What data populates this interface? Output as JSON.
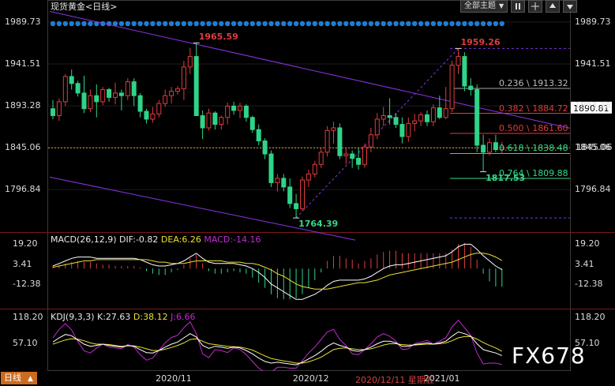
{
  "window": {
    "instrument": "现货黄金",
    "period_label": "<日线>",
    "toolbar": {
      "theme_label": "全部主题",
      "theme_arrow": "▼"
    },
    "period_tab": "日线",
    "period_tab_arrow": "▲"
  },
  "colors": {
    "background": "#000000",
    "up": "#e03c3c",
    "down": "#2fd488",
    "channel": "#8a35e8",
    "fib_line": "#a7a7a7",
    "price_line": "#d9a441",
    "macd_dif": "#ffffff",
    "macd_dea": "#e8e030",
    "macd_pos_bar": "#e03c3c",
    "macd_neg_bar": "#2fd488",
    "kdj_k": "#ffffff",
    "kdj_d": "#e8e030",
    "kdj_j": "#c22ad0",
    "event_dot": "#1e7ed6",
    "accent_red": "#e03c3c",
    "accent_green": "#34d888"
  },
  "chart_data": [
    {
      "type": "candlestick",
      "title": "现货黄金 <日线>",
      "y_ticks": [
        "1989.73",
        "1941.51",
        "1893.28",
        "1845.06",
        "1796.84"
      ],
      "y_tick_values": [
        1989.73,
        1941.51,
        1893.28,
        1845.06,
        1796.84
      ],
      "ylim": [
        1750,
        1995
      ],
      "x_tick_labels": [
        "2020/11",
        "2020/12",
        "2021/01"
      ],
      "x_cursor_label": "2020/12/11 星期五",
      "current_price": "1845.06",
      "last_close_tag": "1845.06",
      "right_marker_price": "1890.81",
      "annotations": [
        {
          "text": "1965.59",
          "value": 1965.59,
          "type": "high"
        },
        {
          "text": "1764.39",
          "value": 1764.39,
          "type": "low"
        },
        {
          "text": "1959.26",
          "value": 1959.26,
          "type": "high"
        },
        {
          "text": "1817.53",
          "value": 1817.53,
          "type": "low"
        }
      ],
      "fibonacci": [
        {
          "label": "0.236 \\ 1913.32",
          "ratio": 0.236,
          "value": 1913.32,
          "color": "#bdbdbd"
        },
        {
          "label": "0.382 \\ 1884.72",
          "ratio": 0.382,
          "value": 1884.72,
          "color": "#e03c3c"
        },
        {
          "label": "0.500 \\ 1861.60",
          "ratio": 0.5,
          "value": 1861.6,
          "color": "#e03c3c"
        },
        {
          "label": "0.618 \\ 1838.48",
          "ratio": 0.618,
          "value": 1838.48,
          "color": "#34d888"
        },
        {
          "label": "0.764 \\ 1809.88",
          "ratio": 0.764,
          "value": 1809.88,
          "color": "#34d888"
        }
      ],
      "fib_top": 1959.26,
      "fib_bottom": 1764.39,
      "candles": [
        {
          "o": 1890,
          "h": 1900,
          "l": 1878,
          "c": 1882
        },
        {
          "o": 1882,
          "h": 1902,
          "l": 1876,
          "c": 1898
        },
        {
          "o": 1898,
          "h": 1930,
          "l": 1893,
          "c": 1927
        },
        {
          "o": 1927,
          "h": 1935,
          "l": 1912,
          "c": 1919
        },
        {
          "o": 1919,
          "h": 1922,
          "l": 1904,
          "c": 1908
        },
        {
          "o": 1908,
          "h": 1928,
          "l": 1885,
          "c": 1890
        },
        {
          "o": 1890,
          "h": 1912,
          "l": 1886,
          "c": 1905
        },
        {
          "o": 1905,
          "h": 1918,
          "l": 1880,
          "c": 1898
        },
        {
          "o": 1898,
          "h": 1915,
          "l": 1894,
          "c": 1912
        },
        {
          "o": 1912,
          "h": 1914,
          "l": 1898,
          "c": 1903
        },
        {
          "o": 1903,
          "h": 1920,
          "l": 1895,
          "c": 1908
        },
        {
          "o": 1908,
          "h": 1912,
          "l": 1888,
          "c": 1905
        },
        {
          "o": 1905,
          "h": 1925,
          "l": 1900,
          "c": 1921
        },
        {
          "o": 1921,
          "h": 1925,
          "l": 1893,
          "c": 1905
        },
        {
          "o": 1905,
          "h": 1908,
          "l": 1880,
          "c": 1887
        },
        {
          "o": 1887,
          "h": 1890,
          "l": 1873,
          "c": 1878
        },
        {
          "o": 1878,
          "h": 1892,
          "l": 1874,
          "c": 1884
        },
        {
          "o": 1884,
          "h": 1900,
          "l": 1880,
          "c": 1896
        },
        {
          "o": 1896,
          "h": 1912,
          "l": 1892,
          "c": 1905
        },
        {
          "o": 1905,
          "h": 1915,
          "l": 1896,
          "c": 1910
        },
        {
          "o": 1910,
          "h": 1916,
          "l": 1906,
          "c": 1913
        },
        {
          "o": 1913,
          "h": 1945,
          "l": 1900,
          "c": 1938
        },
        {
          "o": 1938,
          "h": 1960,
          "l": 1930,
          "c": 1950
        },
        {
          "o": 1950,
          "h": 1965.59,
          "l": 1938,
          "c": 1882
        },
        {
          "o": 1882,
          "h": 1888,
          "l": 1855,
          "c": 1868
        },
        {
          "o": 1868,
          "h": 1890,
          "l": 1865,
          "c": 1885
        },
        {
          "o": 1885,
          "h": 1887,
          "l": 1866,
          "c": 1872
        },
        {
          "o": 1872,
          "h": 1882,
          "l": 1866,
          "c": 1880
        },
        {
          "o": 1880,
          "h": 1897,
          "l": 1872,
          "c": 1893
        },
        {
          "o": 1893,
          "h": 1898,
          "l": 1883,
          "c": 1888
        },
        {
          "o": 1888,
          "h": 1897,
          "l": 1879,
          "c": 1893
        },
        {
          "o": 1893,
          "h": 1895,
          "l": 1875,
          "c": 1880
        },
        {
          "o": 1880,
          "h": 1882,
          "l": 1862,
          "c": 1866
        },
        {
          "o": 1866,
          "h": 1872,
          "l": 1848,
          "c": 1853
        },
        {
          "o": 1853,
          "h": 1856,
          "l": 1832,
          "c": 1838
        },
        {
          "o": 1838,
          "h": 1842,
          "l": 1800,
          "c": 1805
        },
        {
          "o": 1805,
          "h": 1815,
          "l": 1795,
          "c": 1810
        },
        {
          "o": 1810,
          "h": 1815,
          "l": 1795,
          "c": 1800
        },
        {
          "o": 1800,
          "h": 1810,
          "l": 1776,
          "c": 1781
        },
        {
          "o": 1781,
          "h": 1792,
          "l": 1764.39,
          "c": 1775
        },
        {
          "o": 1775,
          "h": 1812,
          "l": 1773,
          "c": 1808
        },
        {
          "o": 1808,
          "h": 1820,
          "l": 1800,
          "c": 1815
        },
        {
          "o": 1815,
          "h": 1830,
          "l": 1811,
          "c": 1826
        },
        {
          "o": 1826,
          "h": 1845,
          "l": 1822,
          "c": 1840
        },
        {
          "o": 1840,
          "h": 1870,
          "l": 1835,
          "c": 1865
        },
        {
          "o": 1865,
          "h": 1875,
          "l": 1850,
          "c": 1868
        },
        {
          "o": 1868,
          "h": 1873,
          "l": 1832,
          "c": 1836
        },
        {
          "o": 1836,
          "h": 1845,
          "l": 1826,
          "c": 1838
        },
        {
          "o": 1838,
          "h": 1842,
          "l": 1822,
          "c": 1833
        },
        {
          "o": 1833,
          "h": 1845,
          "l": 1820,
          "c": 1826
        },
        {
          "o": 1826,
          "h": 1850,
          "l": 1822,
          "c": 1846
        },
        {
          "o": 1846,
          "h": 1868,
          "l": 1840,
          "c": 1860
        },
        {
          "o": 1860,
          "h": 1885,
          "l": 1855,
          "c": 1878
        },
        {
          "o": 1878,
          "h": 1892,
          "l": 1870,
          "c": 1882
        },
        {
          "o": 1882,
          "h": 1902,
          "l": 1872,
          "c": 1880
        },
        {
          "o": 1880,
          "h": 1885,
          "l": 1868,
          "c": 1872
        },
        {
          "o": 1872,
          "h": 1880,
          "l": 1850,
          "c": 1858
        },
        {
          "o": 1858,
          "h": 1880,
          "l": 1852,
          "c": 1873
        },
        {
          "o": 1873,
          "h": 1884,
          "l": 1864,
          "c": 1876
        },
        {
          "o": 1876,
          "h": 1886,
          "l": 1870,
          "c": 1883
        },
        {
          "o": 1883,
          "h": 1888,
          "l": 1870,
          "c": 1875
        },
        {
          "o": 1875,
          "h": 1895,
          "l": 1870,
          "c": 1891
        },
        {
          "o": 1891,
          "h": 1905,
          "l": 1878,
          "c": 1880
        },
        {
          "o": 1880,
          "h": 1915,
          "l": 1878,
          "c": 1890
        },
        {
          "o": 1890,
          "h": 1945,
          "l": 1886,
          "c": 1940
        },
        {
          "o": 1940,
          "h": 1959.26,
          "l": 1930,
          "c": 1950
        },
        {
          "o": 1950,
          "h": 1955,
          "l": 1910,
          "c": 1916
        },
        {
          "o": 1916,
          "h": 1925,
          "l": 1905,
          "c": 1912
        },
        {
          "o": 1912,
          "h": 1918,
          "l": 1840,
          "c": 1848
        },
        {
          "o": 1848,
          "h": 1860,
          "l": 1817.53,
          "c": 1840
        },
        {
          "o": 1840,
          "h": 1856,
          "l": 1836,
          "c": 1851
        },
        {
          "o": 1851,
          "h": 1860,
          "l": 1840,
          "c": 1843
        },
        {
          "o": 1843,
          "h": 1852,
          "l": 1838,
          "c": 1845.06
        }
      ]
    },
    {
      "type": "macd",
      "title": "MACD(26,12,9)",
      "legend": [
        {
          "label": "DIF:-0.82",
          "color": "#ffffff"
        },
        {
          "label": "DEA:6.26",
          "color": "#e8e030"
        },
        {
          "label": "MACD:-14.16",
          "color": "#c22ad0"
        }
      ],
      "y_ticks": [
        "19.20",
        "3.41",
        "-12.38"
      ],
      "y_tick_values": [
        19.2,
        3.41,
        -12.38
      ],
      "ylim": [
        -30,
        26
      ],
      "dif": [
        2,
        4,
        6,
        8,
        9,
        9,
        9,
        8,
        8,
        8,
        8,
        8,
        8,
        8,
        7,
        5,
        3,
        2,
        2,
        3,
        4,
        6,
        9,
        12,
        8,
        5,
        4,
        4,
        4,
        4,
        3,
        2,
        0,
        -3,
        -7,
        -12,
        -15,
        -18,
        -21,
        -24,
        -24,
        -22,
        -20,
        -17,
        -13,
        -10,
        -9,
        -9,
        -9,
        -9,
        -8,
        -6,
        -3,
        0,
        2,
        3,
        3,
        4,
        5,
        6,
        7,
        8,
        9,
        10,
        13,
        17,
        19,
        19,
        15,
        10,
        6,
        2,
        -0.82
      ],
      "dea": [
        1,
        2,
        3,
        4,
        5,
        6,
        6,
        7,
        7,
        7,
        7,
        7,
        7,
        7,
        7,
        7,
        6,
        5,
        5,
        4,
        4,
        4,
        5,
        6,
        6,
        6,
        6,
        6,
        5,
        5,
        5,
        4,
        4,
        3,
        1,
        -1,
        -4,
        -6,
        -9,
        -12,
        -14,
        -15,
        -16,
        -16,
        -16,
        -15,
        -14,
        -13,
        -12,
        -11,
        -11,
        -10,
        -9,
        -7,
        -5,
        -4,
        -3,
        -2,
        -1,
        0,
        1,
        2,
        3,
        4,
        5,
        7,
        9,
        11,
        12,
        12,
        11,
        9,
        6.26
      ],
      "hist": [
        2,
        3,
        4,
        5,
        6,
        5,
        5,
        4,
        3,
        3,
        2,
        2,
        2,
        2,
        1,
        -2,
        -4,
        -5,
        -5,
        -3,
        -1,
        3,
        8,
        11,
        4,
        -2,
        -4,
        -4,
        -3,
        -2,
        -3,
        -4,
        -7,
        -11,
        -15,
        -20,
        -23,
        -24,
        -24,
        -23,
        -20,
        -15,
        -9,
        -3,
        6,
        10,
        10,
        8,
        7,
        4,
        6,
        8,
        11,
        13,
        14,
        14,
        12,
        12,
        12,
        12,
        12,
        12,
        12,
        12,
        15,
        19,
        20,
        17,
        7,
        -4,
        -10,
        -14,
        -14.16
      ]
    },
    {
      "type": "kdj",
      "title": "KDJ(9,3,3)",
      "legend": [
        {
          "label": "K:27.63",
          "color": "#ffffff"
        },
        {
          "label": "D:38.12",
          "color": "#e8e030"
        },
        {
          "label": "J:6.66",
          "color": "#c22ad0"
        }
      ],
      "y_ticks": [
        "118.20",
        "57.10"
      ],
      "y_tick_values": [
        118.2,
        57.1
      ],
      "ylim": [
        -5,
        130
      ],
      "k": [
        60,
        70,
        78,
        75,
        65,
        55,
        50,
        52,
        55,
        52,
        50,
        48,
        52,
        50,
        42,
        35,
        34,
        40,
        48,
        55,
        60,
        70,
        80,
        72,
        52,
        45,
        50,
        48,
        45,
        48,
        46,
        40,
        32,
        22,
        14,
        10,
        12,
        10,
        8,
        6,
        12,
        20,
        28,
        38,
        50,
        58,
        52,
        48,
        40,
        38,
        42,
        48,
        56,
        62,
        62,
        58,
        50,
        50,
        54,
        56,
        58,
        55,
        58,
        62,
        74,
        84,
        80,
        74,
        56,
        42,
        38,
        34,
        27.63
      ],
      "d": [
        55,
        60,
        65,
        68,
        67,
        63,
        58,
        55,
        55,
        54,
        52,
        50,
        51,
        51,
        48,
        44,
        40,
        40,
        43,
        47,
        52,
        58,
        66,
        68,
        62,
        56,
        54,
        52,
        50,
        49,
        48,
        45,
        41,
        34,
        27,
        21,
        18,
        15,
        13,
        10,
        10,
        13,
        18,
        24,
        33,
        42,
        45,
        46,
        44,
        42,
        42,
        44,
        48,
        53,
        56,
        56,
        54,
        53,
        53,
        54,
        55,
        55,
        56,
        58,
        63,
        70,
        73,
        73,
        67,
        59,
        52,
        46,
        38.12
      ],
      "j": [
        70,
        90,
        104,
        89,
        61,
        39,
        34,
        46,
        55,
        48,
        46,
        44,
        54,
        48,
        30,
        17,
        22,
        40,
        58,
        71,
        76,
        94,
        108,
        80,
        32,
        23,
        42,
        40,
        35,
        46,
        42,
        30,
        14,
        -2,
        -12,
        -12,
        0,
        0,
        -2,
        -2,
        16,
        34,
        48,
        66,
        84,
        90,
        66,
        52,
        32,
        30,
        42,
        56,
        72,
        80,
        74,
        62,
        42,
        44,
        56,
        60,
        64,
        55,
        62,
        70,
        96,
        112,
        94,
        76,
        34,
        8,
        10,
        10,
        6.66
      ]
    }
  ]
}
